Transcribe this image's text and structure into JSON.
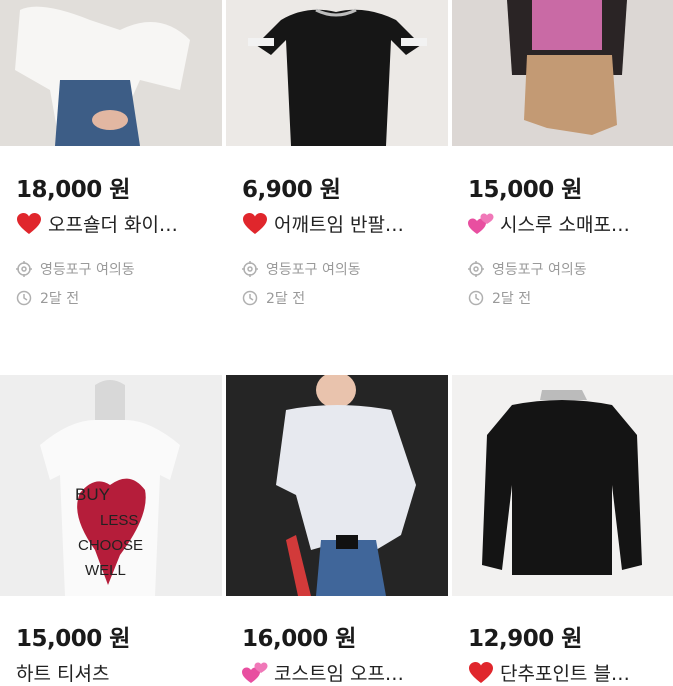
{
  "products": [
    {
      "price": "18,000 원",
      "title": "오프숄더 화이…",
      "emoji": "heart-emoji",
      "location": "영등포구 여의동",
      "time": "2달 전"
    },
    {
      "price": "6,900 원",
      "title": "어깨트임 반팔…",
      "emoji": "heart-emoji",
      "location": "영등포구 여의동",
      "time": "2달 전"
    },
    {
      "price": "15,000 원",
      "title": "시스루 소매포…",
      "emoji": "two-hearts-emoji",
      "location": "영등포구 여의동",
      "time": "2달 전"
    },
    {
      "price": "15,000 원",
      "title": "하트 티셔츠",
      "emoji": "",
      "location": "",
      "time": ""
    },
    {
      "price": "16,000 원",
      "title": "코스트임 오프…",
      "emoji": "two-hearts-emoji",
      "location": "",
      "time": ""
    },
    {
      "price": "12,900 원",
      "title": "단추포인트 블…",
      "emoji": "heart-emoji",
      "location": "",
      "time": ""
    }
  ],
  "image_texts": {
    "shirt_print": [
      "BUY",
      "LESS",
      "CHOOSE",
      "WELL"
    ]
  },
  "colors": {
    "price_text": "#1a1a1a",
    "meta_text": "#9a9a9a",
    "heart_red": "#e0262c",
    "two_hearts_pink": "#e84fa0"
  }
}
